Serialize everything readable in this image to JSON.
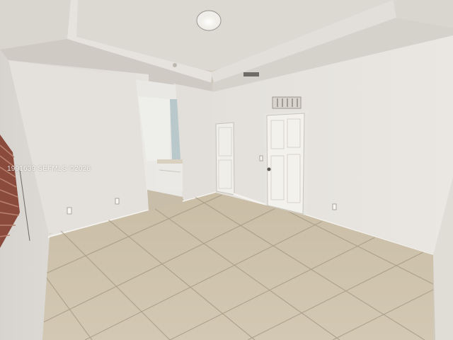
{
  "photo": {
    "watermark_text": "1991639 SEFMLS ©2026",
    "colors": {
      "ceiling": "#ddd9d3",
      "walls": "#e8e5e0",
      "floor_tile": "#cbbfa9",
      "grout": "#a89c87",
      "door": "#f1efea",
      "blinds": "#8a4b3c"
    },
    "icons": [
      "ceiling-light-icon",
      "air-vent-icon",
      "door-knob-icon"
    ]
  }
}
